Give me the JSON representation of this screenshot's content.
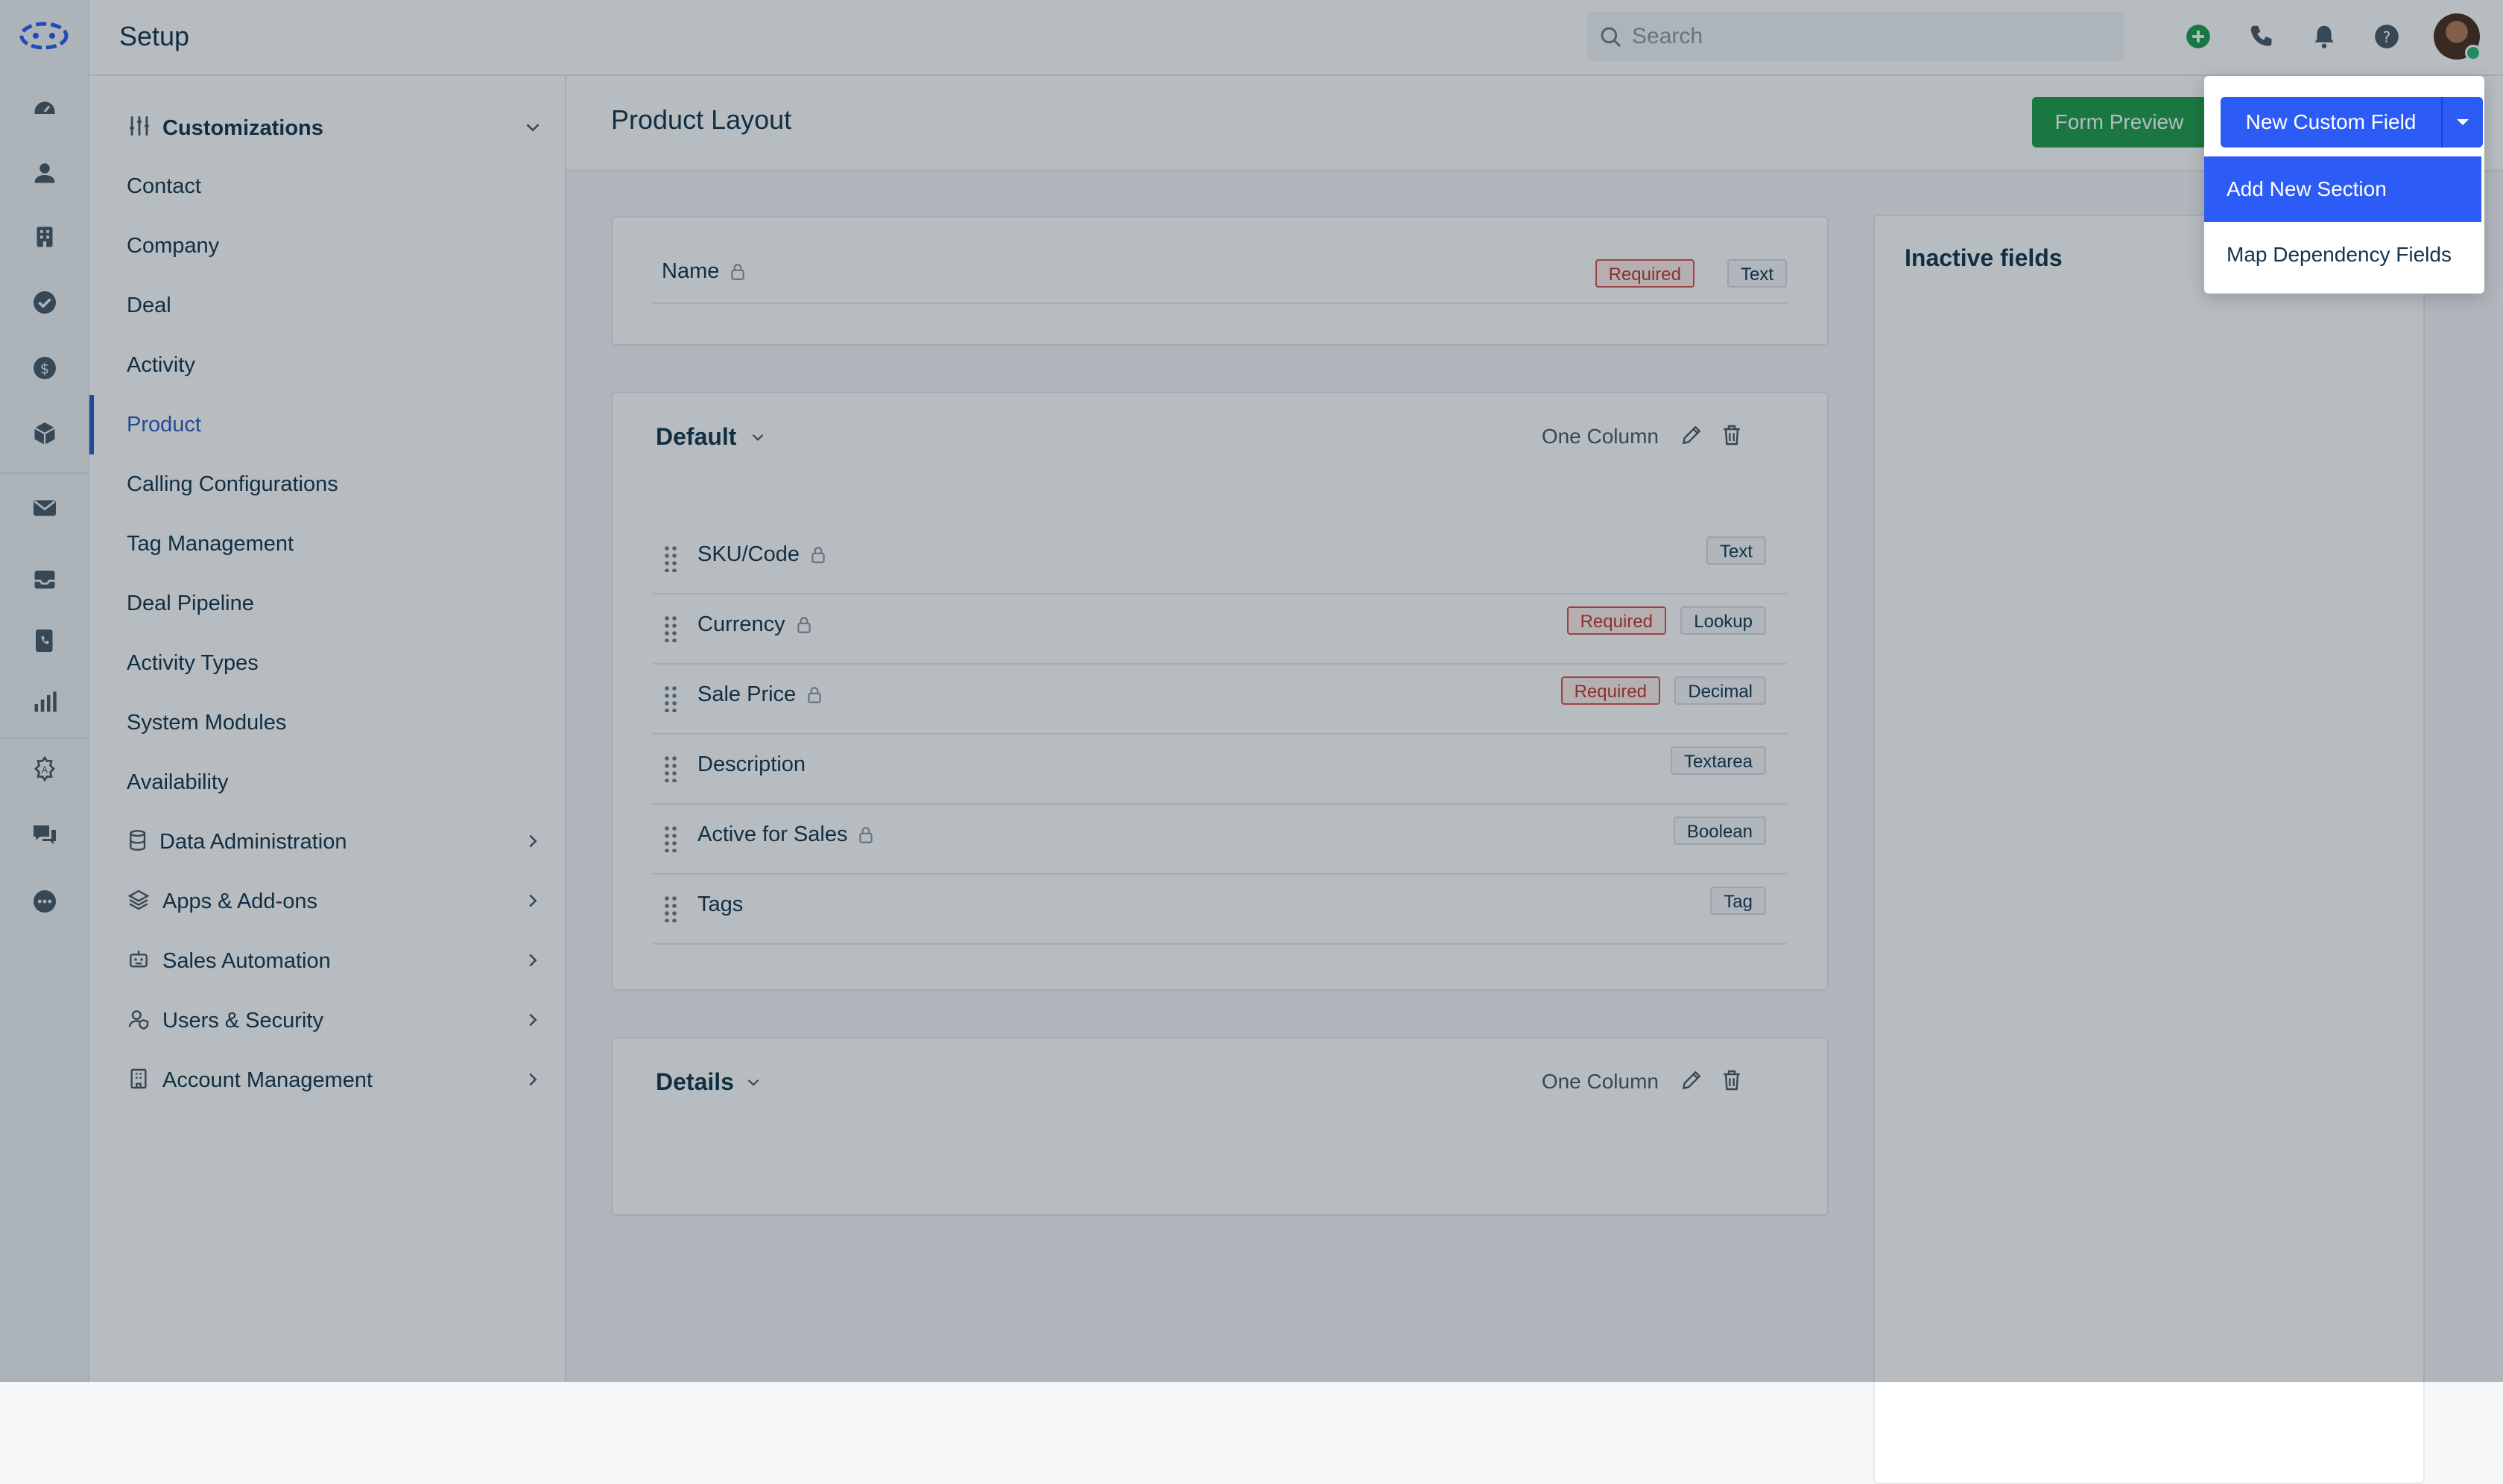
{
  "header": {
    "title": "Setup",
    "search_placeholder": "Search"
  },
  "nav": {
    "group_label": "Customizations",
    "items": [
      "Contact",
      "Company",
      "Deal",
      "Activity",
      "Product",
      "Calling Configurations",
      "Tag Management",
      "Deal Pipeline",
      "Activity Types",
      "System Modules",
      "Availability"
    ],
    "active_item": "Product",
    "sub_groups": [
      "Data Administration",
      "Apps & Add-ons",
      "Sales Automation",
      "Users & Security",
      "Account Management"
    ]
  },
  "page": {
    "title": "Product Layout",
    "form_preview_label": "Form Preview",
    "new_custom_field_label": "New Custom Field"
  },
  "name_field": {
    "label": "Name",
    "required": "Required",
    "type": "Text"
  },
  "sections": [
    {
      "title": "Default",
      "layout": "One Column",
      "fields": [
        {
          "label": "SKU/Code",
          "locked": true,
          "required": "",
          "type": "Text"
        },
        {
          "label": "Currency",
          "locked": true,
          "required": "Required",
          "type": "Lookup"
        },
        {
          "label": "Sale Price",
          "locked": true,
          "required": "Required",
          "type": "Decimal"
        },
        {
          "label": "Description",
          "locked": false,
          "required": "",
          "type": "Textarea"
        },
        {
          "label": "Active for Sales",
          "locked": true,
          "required": "",
          "type": "Boolean"
        },
        {
          "label": "Tags",
          "locked": false,
          "required": "",
          "type": "Tag"
        }
      ]
    },
    {
      "title": "Details",
      "layout": "One Column",
      "fields": []
    }
  ],
  "inactive_panel": {
    "title": "Inactive fields"
  },
  "dropdown": {
    "options": [
      "Add New Section",
      "Map Dependency Fields"
    ],
    "highlighted": "Add New Section"
  },
  "colors": {
    "primary": "#2c5cf5",
    "success": "#1f9d4a",
    "danger": "#d9534f",
    "nav_active": "#2c5cc5"
  }
}
